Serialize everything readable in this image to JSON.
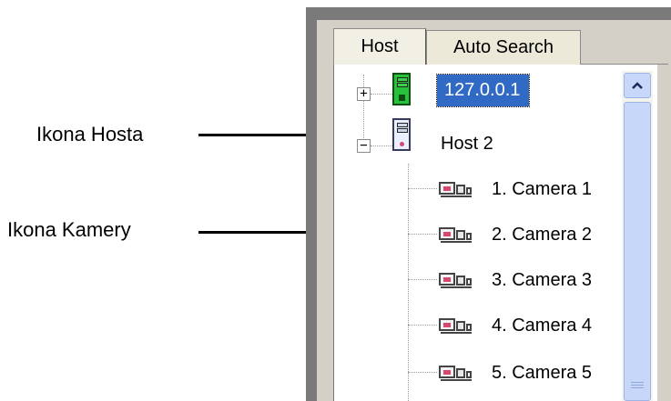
{
  "annotations": {
    "host_icon_label": "Ikona Hosta",
    "camera_icon_label": "Ikona Kamery"
  },
  "tabs": [
    {
      "label": "Host",
      "active": true
    },
    {
      "label": "Auto Search",
      "active": false
    }
  ],
  "tree": {
    "hosts": [
      {
        "label": "127.0.0.1",
        "expanded": false,
        "selected": true,
        "icon": "host-icon-green"
      },
      {
        "label": "Host 2",
        "expanded": true,
        "selected": false,
        "icon": "host-icon-gray"
      }
    ],
    "cameras": [
      {
        "label": "1. Camera 1"
      },
      {
        "label": "2. Camera 2"
      },
      {
        "label": "3. Camera 3"
      },
      {
        "label": "4. Camera 4"
      },
      {
        "label": "5. Camera 5"
      }
    ],
    "expander_collapsed": "+",
    "expander_expanded": "−"
  },
  "colors": {
    "selection": "#316ac5",
    "host_online": "#27c23a",
    "scrollbar": "#c7d7fa"
  }
}
